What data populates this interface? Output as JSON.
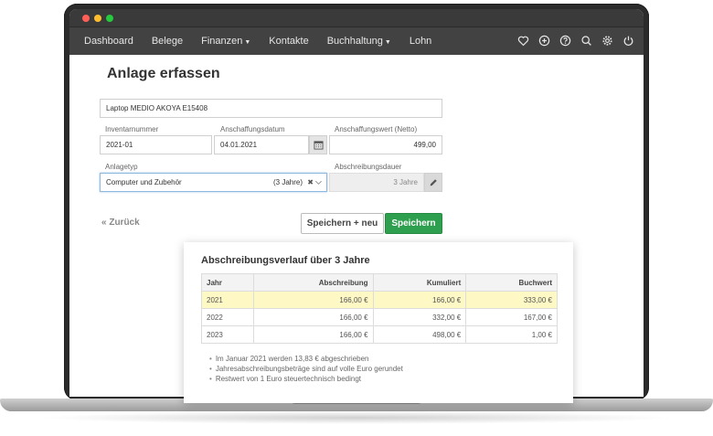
{
  "nav": {
    "items": [
      {
        "label": "Dashboard",
        "dropdown": false
      },
      {
        "label": "Belege",
        "dropdown": false
      },
      {
        "label": "Finanzen",
        "dropdown": true
      },
      {
        "label": "Kontakte",
        "dropdown": false
      },
      {
        "label": "Buchhaltung",
        "dropdown": true
      },
      {
        "label": "Lohn",
        "dropdown": false
      }
    ],
    "icons": [
      "heart-icon",
      "plus-circle-icon",
      "help-icon",
      "search-icon",
      "gear-icon",
      "power-icon"
    ]
  },
  "form": {
    "title": "Anlage erfassen",
    "name_value": "Laptop MEDIO AKOYA E15408",
    "inventory": {
      "label": "Inventarnummer",
      "value": "2021-01"
    },
    "purchase_date": {
      "label": "Anschaffungsdatum",
      "value": "04.01.2021"
    },
    "purchase_value": {
      "label": "Anschaffungswert (Netto)",
      "value": "499,00"
    },
    "asset_type": {
      "label": "Anlagetyp",
      "value": "Computer und Zubehör",
      "suffix": "(3 Jahre)"
    },
    "duration": {
      "label": "Abschreibungsdauer",
      "value": "3 Jahre"
    },
    "back_label": "« Zurück",
    "save_new_label": "Speichern + neu",
    "save_label": "Speichern"
  },
  "depreciation": {
    "title": "Abschreibungsverlauf über 3 Jahre",
    "headers": [
      "Jahr",
      "Abschreibung",
      "Kumuliert",
      "Buchwert"
    ],
    "rows": [
      [
        "2021",
        "166,00 €",
        "166,00 €",
        "333,00 €"
      ],
      [
        "2022",
        "166,00 €",
        "332,00 €",
        "167,00 €"
      ],
      [
        "2023",
        "166,00 €",
        "498,00 €",
        "1,00 €"
      ]
    ],
    "notes": [
      "Im Januar 2021 werden 13,83 € abgeschrieben",
      "Jahresabschreibungsbeträge sind auf volle Euro gerundet",
      "Restwert von 1 Euro steuertechnisch bedingt"
    ]
  },
  "colors": {
    "primary_button": "#2e9e4f",
    "navbar": "#424242",
    "highlight_row": "#fdf8c4"
  }
}
